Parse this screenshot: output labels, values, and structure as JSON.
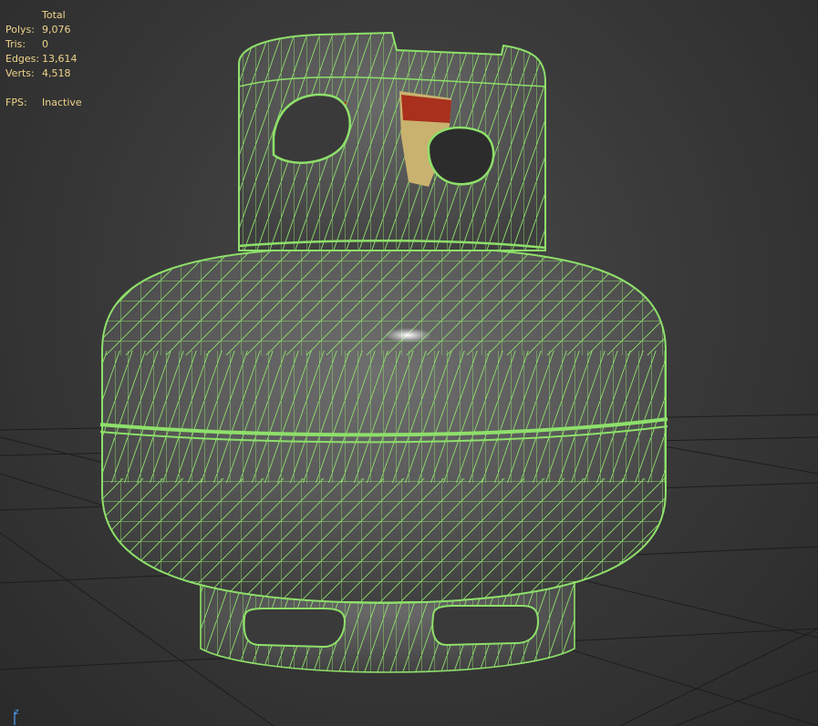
{
  "stats": {
    "header": "Total",
    "rows": [
      {
        "label": "Polys:",
        "value": "9,076"
      },
      {
        "label": "Tris:",
        "value": "0"
      },
      {
        "label": "Edges:",
        "value": "13,614"
      },
      {
        "label": "Verts:",
        "value": "4,518"
      }
    ],
    "fps_label": "FPS:",
    "fps_value": "Inactive"
  },
  "axis": {
    "z_label": "z"
  },
  "colors": {
    "wire": "#8ee06a",
    "text": "#f0d38a",
    "grid": "#1c1c1c",
    "axis_z": "#4fa3ff"
  },
  "object": {
    "icon": "propane-tank-wireframe-mesh"
  }
}
